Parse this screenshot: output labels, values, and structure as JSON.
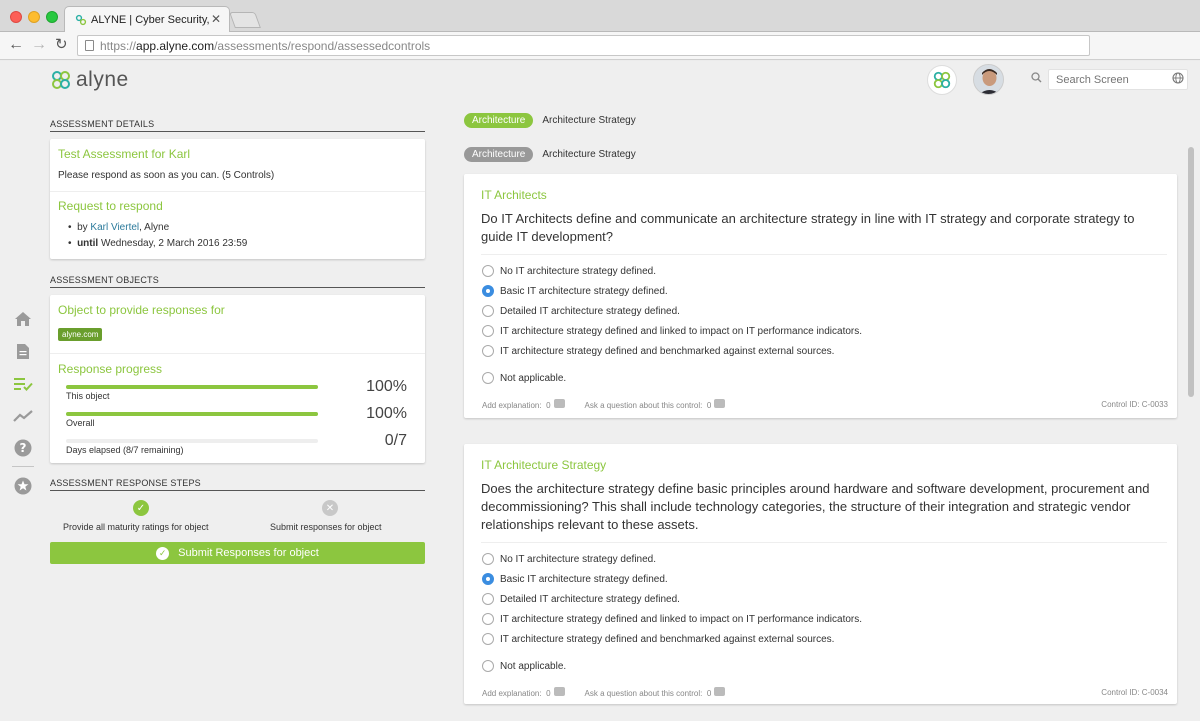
{
  "browser": {
    "tab_title": "ALYNE | Cyber Security, Ri",
    "tab_close": "✕",
    "url_scheme": "https://",
    "url_domain": "app.alyne.com",
    "url_path": "/assessments/respond/assessedcontrols"
  },
  "header": {
    "logo_text": "alyne",
    "search_placeholder": "Search Screen",
    "colors": {
      "brand_green": "#8cc63f",
      "brand_teal": "#2bb0a5"
    }
  },
  "sidenav": {
    "items": [
      "home-icon",
      "document-icon",
      "checklist-icon",
      "trend-icon",
      "help-icon",
      "star-icon"
    ]
  },
  "assessment_details": {
    "section_title": "ASSESSMENT DETAILS",
    "title": "Test Assessment for Karl",
    "description": "Please respond as soon as you can. (5 Controls)",
    "request_title": "Request to respond",
    "by_label": "by",
    "by_name": "Karl Viertel",
    "by_org": ", Alyne",
    "until_label": "until",
    "until_date": "Wednesday, 2 March 2016 23:59"
  },
  "assessment_objects": {
    "section_title": "ASSESSMENT OBJECTS",
    "object_title": "Object to provide responses for",
    "object_pill": "alyne.com",
    "progress_title": "Response progress",
    "progress": [
      {
        "label": "This object",
        "value_text": "100%",
        "fraction": 1.0
      },
      {
        "label": "Overall",
        "value_text": "100%",
        "fraction": 1.0
      },
      {
        "label": "Days elapsed (8/7 remaining)",
        "value_text": "0/7",
        "fraction": 0.0
      }
    ]
  },
  "response_steps": {
    "section_title": "ASSESSMENT RESPONSE STEPS",
    "step1_label": "Provide all maturity ratings for object",
    "step2_label": "Submit responses for object",
    "submit_label": "Submit Responses for object"
  },
  "breadcrumbs": [
    {
      "pill": "Architecture",
      "text": "Architecture Strategy",
      "color": "#8cc63f"
    },
    {
      "pill": "Architecture",
      "text": "Architecture Strategy",
      "color": "#999999"
    }
  ],
  "questions": [
    {
      "title": "IT Architects",
      "text": "Do IT Architects define and communicate an architecture strategy in line with IT strategy and corporate strategy to guide IT development?",
      "options": [
        "No IT architecture strategy defined.",
        "Basic IT architecture strategy defined.",
        "Detailed IT architecture strategy defined.",
        "IT architecture strategy defined and linked to impact on IT performance indicators.",
        "IT architecture strategy defined and benchmarked against external sources."
      ],
      "na_option": "Not applicable.",
      "selected_index": 1,
      "add_explanation": "Add explanation:",
      "explanation_count": "0",
      "ask_question": "Ask a question about this control:",
      "question_count": "0",
      "control_id": "Control ID: C-0033"
    },
    {
      "title": "IT Architecture Strategy",
      "text": "Does the architecture strategy define basic principles around hardware and software development, procurement and decommissioning? This shall include technology categories, the structure of their integration and strategic vendor relationships relevant to these assets.",
      "options": [
        "No IT architecture strategy defined.",
        "Basic IT architecture strategy defined.",
        "Detailed IT architecture strategy defined.",
        "IT architecture strategy defined and linked to impact on IT performance indicators.",
        "IT architecture strategy defined and benchmarked against external sources."
      ],
      "na_option": "Not applicable.",
      "selected_index": 1,
      "add_explanation": "Add explanation:",
      "explanation_count": "0",
      "ask_question": "Ask a question about this control:",
      "question_count": "0",
      "control_id": "Control ID: C-0034"
    }
  ]
}
